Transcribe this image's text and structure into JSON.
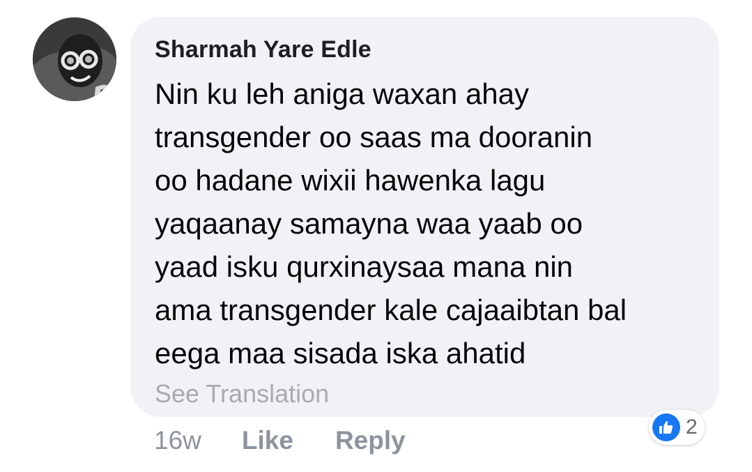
{
  "comment": {
    "author": "Sharmah Yare Edle",
    "text": "Nin ku leh aniga waxan ahay\ntransgender oo saas ma dooranin\noo hadane wixii hawenka lagu\nyaqaanay samayna waa yaab oo\nyaad isku qurxinaysaa mana nin\nama transgender kale cajaaibtan bal\neega maa sisada iska ahatid",
    "see_translation": "See Translation",
    "time": "16w",
    "like_label": "Like",
    "reply_label": "Reply",
    "reactions": {
      "icon": "thumbs-up-icon",
      "count": "2",
      "color": "#1877f2"
    }
  }
}
